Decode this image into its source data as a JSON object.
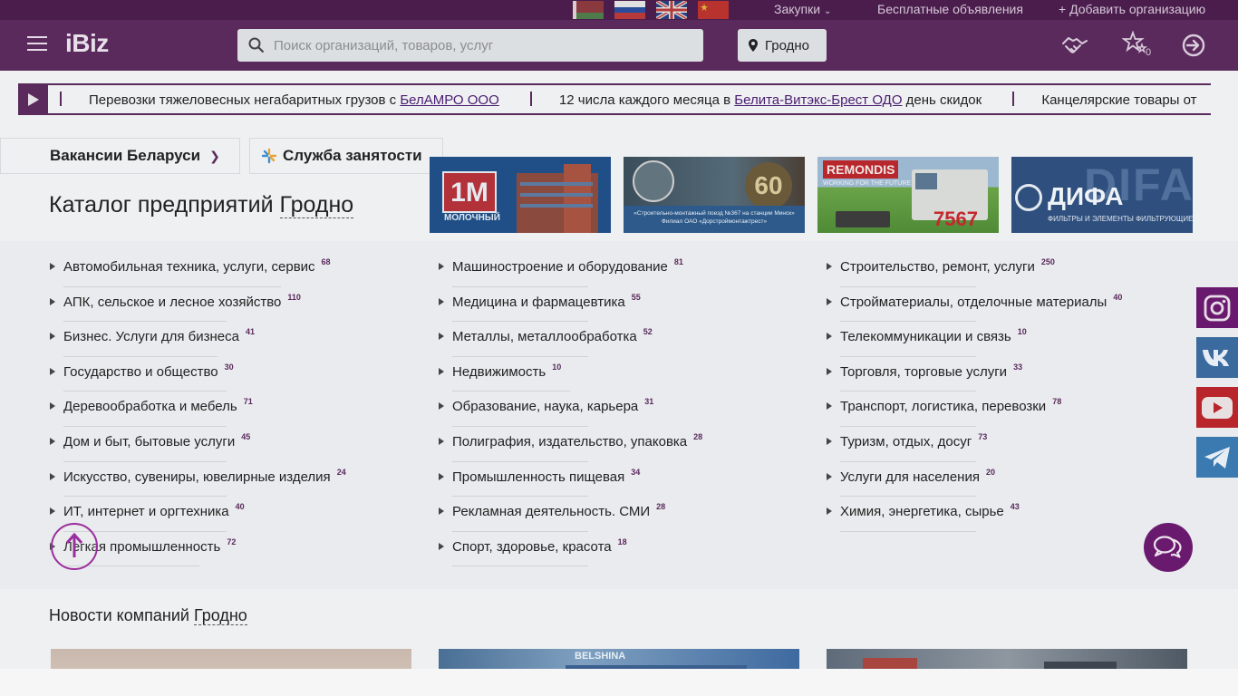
{
  "topbar": {
    "languages": [
      "be-flag-icon",
      "ru-flag-icon",
      "uk-flag-icon",
      "cn-flag-icon"
    ],
    "purchases": "Закупки",
    "free_ads": "Бесплатные объявления",
    "add_org": "Добавить организацию"
  },
  "header": {
    "logo": "iBiz",
    "search_placeholder": "Поиск организаций, товаров, услуг",
    "city": "Гродно",
    "favorites_count": "0"
  },
  "ticker": {
    "items": [
      {
        "text": "Перевозки тяжеловесных негабаритных грузов с ",
        "link": "БелАМРО ООО",
        "after": ""
      },
      {
        "text": "12 числа каждого месяца в ",
        "link": "Белита-Витэкс-Брест ОДО",
        "after": " день скидок"
      },
      {
        "text": "Канцелярские товары от",
        "link": "",
        "after": ""
      }
    ]
  },
  "tabs": {
    "vacancies": "Вакансии Беларуси",
    "employment": "Служба занятости"
  },
  "catalog": {
    "title": "Каталог предприятий",
    "city": "Гродно",
    "columns": [
      [
        {
          "name": "Автомобильная техника, услуги, сервис",
          "count": "68"
        },
        {
          "name": "АПК, сельское и лесное хозяйство",
          "count": "110"
        },
        {
          "name": "Бизнес. Услуги для бизнеса",
          "count": "41"
        },
        {
          "name": "Государство и общество",
          "count": "30"
        },
        {
          "name": "Деревообработка и мебель",
          "count": "71"
        },
        {
          "name": "Дом и быт, бытовые услуги",
          "count": "45"
        },
        {
          "name": "Искусство, сувениры, ювелирные изделия",
          "count": "24"
        },
        {
          "name": "ИТ, интернет и оргтехника",
          "count": "40"
        },
        {
          "name": "Легкая промышленность",
          "count": "72"
        }
      ],
      [
        {
          "name": "Машиностроение и оборудование",
          "count": "81"
        },
        {
          "name": "Медицина и фармацевтика",
          "count": "55"
        },
        {
          "name": "Металлы, металлообработка",
          "count": "52"
        },
        {
          "name": "Недвижимость",
          "count": "10"
        },
        {
          "name": "Образование, наука, карьера",
          "count": "31"
        },
        {
          "name": "Полиграфия, издательство, упаковка",
          "count": "28"
        },
        {
          "name": "Промышленность пищевая",
          "count": "34"
        },
        {
          "name": "Рекламная деятельность. СМИ",
          "count": "28"
        },
        {
          "name": "Спорт, здоровье, красота",
          "count": "18"
        }
      ],
      [
        {
          "name": "Строительство, ремонт, услуги",
          "count": "250"
        },
        {
          "name": "Стройматериалы, отделочные материалы",
          "count": "40"
        },
        {
          "name": "Телекоммуникации и связь",
          "count": "10"
        },
        {
          "name": "Торговля, торговые услуги",
          "count": "33"
        },
        {
          "name": "Транспорт, логистика, перевозки",
          "count": "78"
        },
        {
          "name": "Туризм, отдых, досуг",
          "count": "73"
        },
        {
          "name": "Услуги для населения",
          "count": "20"
        },
        {
          "name": "Химия, энергетика, сырье",
          "count": "43"
        }
      ]
    ]
  },
  "banners": [
    {
      "logo": "1М",
      "caption": "МОЛОЧНЫЙ"
    },
    {
      "caption": "«Строительно-монтажный поезд №367 на станции Минск» Филиал ОАО «Дорстроймонтажтрест»",
      "badge": "60"
    },
    {
      "logo": "REMONDIS",
      "tagline": "WORKING FOR THE FUTURE",
      "number": "7567"
    },
    {
      "logo": "ДИФА",
      "caption": "ФИЛЬТРЫ И ЭЛЕМЕНТЫ ФИЛЬТРУЮЩИЕ"
    }
  ],
  "social": [
    "instagram-icon",
    "vk-icon",
    "youtube-icon",
    "telegram-icon"
  ],
  "news": {
    "title": "Новости компаний",
    "city": "Гродно",
    "cards": [
      {
        "label": ""
      },
      {
        "label": "BELSHINA"
      },
      {
        "label": ""
      }
    ]
  },
  "colors": {
    "brand": "#5a2a5c",
    "topbar": "#4a1d4c",
    "accent": "#9b2e9e"
  }
}
